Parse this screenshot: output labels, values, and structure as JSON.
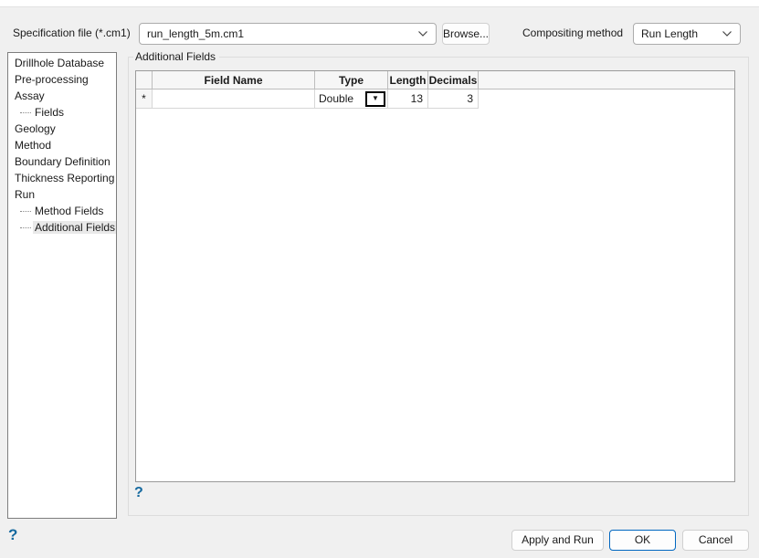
{
  "header": {
    "spec_label": "Specification file (*.cm1)",
    "spec_value": "run_length_5m.cm1",
    "browse_label": "Browse...",
    "method_label": "Compositing method",
    "method_value": "Run Length"
  },
  "sidebar": {
    "items": [
      {
        "label": "Drillhole Database",
        "level": 0,
        "selected": false
      },
      {
        "label": "Pre-processing",
        "level": 0,
        "selected": false
      },
      {
        "label": "Assay",
        "level": 0,
        "selected": false
      },
      {
        "label": "Fields",
        "level": 1,
        "selected": false
      },
      {
        "label": "Geology",
        "level": 0,
        "selected": false
      },
      {
        "label": "Method",
        "level": 0,
        "selected": false
      },
      {
        "label": "Boundary Definition",
        "level": 0,
        "selected": false
      },
      {
        "label": "Thickness Reporting",
        "level": 0,
        "selected": false
      },
      {
        "label": "Run",
        "level": 0,
        "selected": false
      },
      {
        "label": "Method Fields",
        "level": 1,
        "selected": false
      },
      {
        "label": "Additional Fields",
        "level": 1,
        "selected": true
      }
    ]
  },
  "main": {
    "group_title": "Additional Fields",
    "table": {
      "headers": [
        "Field Name",
        "Type",
        "Length",
        "Decimals"
      ],
      "row": {
        "marker": "*",
        "field_name": "",
        "type_value": "Double",
        "length": "13",
        "decimals": "3"
      }
    },
    "help_icon": "?"
  },
  "footer": {
    "help_icon": "?",
    "apply_label": "Apply and Run",
    "ok_label": "OK",
    "cancel_label": "Cancel"
  },
  "icons": {
    "dropdown_glyph": "▼"
  },
  "colors": {
    "accent_blue": "#0067c0",
    "help_blue": "#15699f",
    "dialog_bg": "#f0f0f0"
  }
}
